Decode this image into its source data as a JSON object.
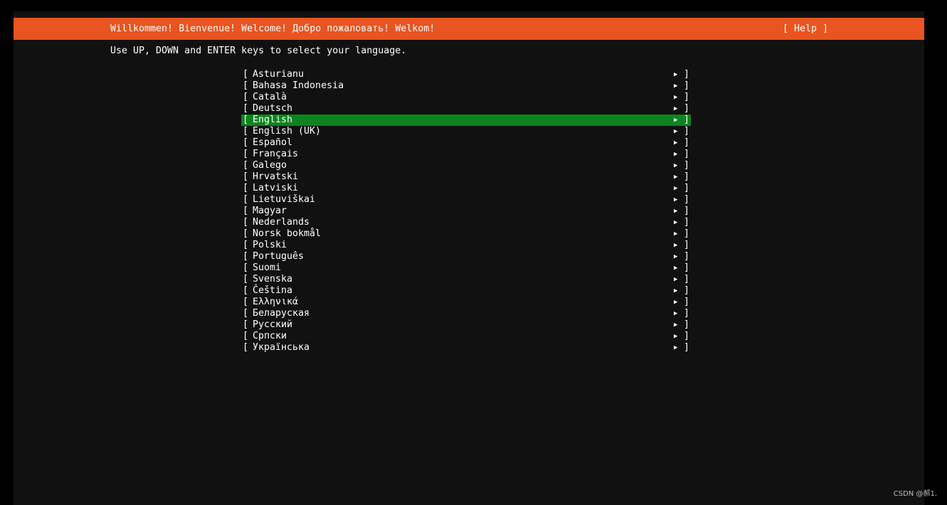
{
  "header": {
    "title": "Willkommen! Bienvenue! Welcome! Добро пожаловать! Welkom!",
    "help_label": "[ Help ]"
  },
  "instruction": "Use UP, DOWN and ENTER keys to select your language.",
  "list": {
    "open_bracket": "[",
    "close_bracket": "]",
    "arrow": "▶",
    "languages": [
      {
        "label": "Asturianu",
        "selected": false
      },
      {
        "label": "Bahasa Indonesia",
        "selected": false
      },
      {
        "label": "Català",
        "selected": false
      },
      {
        "label": "Deutsch",
        "selected": false
      },
      {
        "label": "English",
        "selected": true
      },
      {
        "label": "English (UK)",
        "selected": false
      },
      {
        "label": "Español",
        "selected": false
      },
      {
        "label": "Français",
        "selected": false
      },
      {
        "label": "Galego",
        "selected": false
      },
      {
        "label": "Hrvatski",
        "selected": false
      },
      {
        "label": "Latviski",
        "selected": false
      },
      {
        "label": "Lietuviškai",
        "selected": false
      },
      {
        "label": "Magyar",
        "selected": false
      },
      {
        "label": "Nederlands",
        "selected": false
      },
      {
        "label": "Norsk bokmål",
        "selected": false
      },
      {
        "label": "Polski",
        "selected": false
      },
      {
        "label": "Português",
        "selected": false
      },
      {
        "label": "Suomi",
        "selected": false
      },
      {
        "label": "Svenska",
        "selected": false
      },
      {
        "label": "Čeština",
        "selected": false
      },
      {
        "label": "Ελληνικά",
        "selected": false
      },
      {
        "label": "Беларуская",
        "selected": false
      },
      {
        "label": "Русский",
        "selected": false
      },
      {
        "label": "Српски",
        "selected": false
      },
      {
        "label": "Українська",
        "selected": false
      }
    ]
  },
  "watermark": "CSDN @郝1.",
  "colors": {
    "header_bg": "#E95420",
    "selected_bg": "#0E8420",
    "screen_bg": "#111111"
  }
}
